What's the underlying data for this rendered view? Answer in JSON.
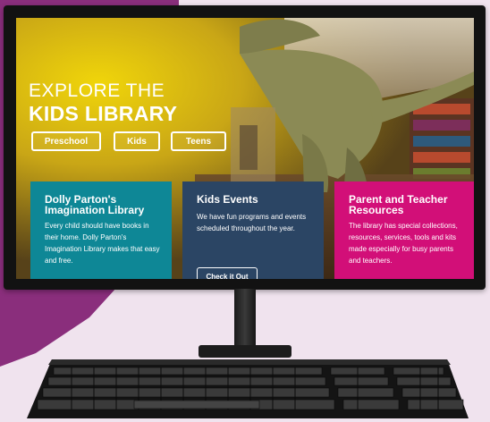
{
  "hero": {
    "title_line1": "EXPLORE THE",
    "title_line2": "KIDS LIBRARY",
    "buttons": [
      "Preschool",
      "Kids",
      "Teens"
    ]
  },
  "cards": [
    {
      "title": "Dolly Parton's Imagination Library",
      "body": "Every child should have books in their home. Dolly Parton's Imagination Library makes that easy and free.",
      "color": "#0e8796"
    },
    {
      "title": "Kids Events",
      "body": "We have fun programs and events scheduled throughout the year.",
      "button": "Check it Out",
      "color": "#2b4564"
    },
    {
      "title": "Parent and Teacher Resources",
      "body": "The library has special collections, resources, services, tools and kits made especially for busy parents and teachers.",
      "color": "#d20f78"
    }
  ],
  "colors": {
    "backdrop": "#f0e3ee",
    "purple": "#8a2e7c",
    "monitor": "#121212"
  }
}
